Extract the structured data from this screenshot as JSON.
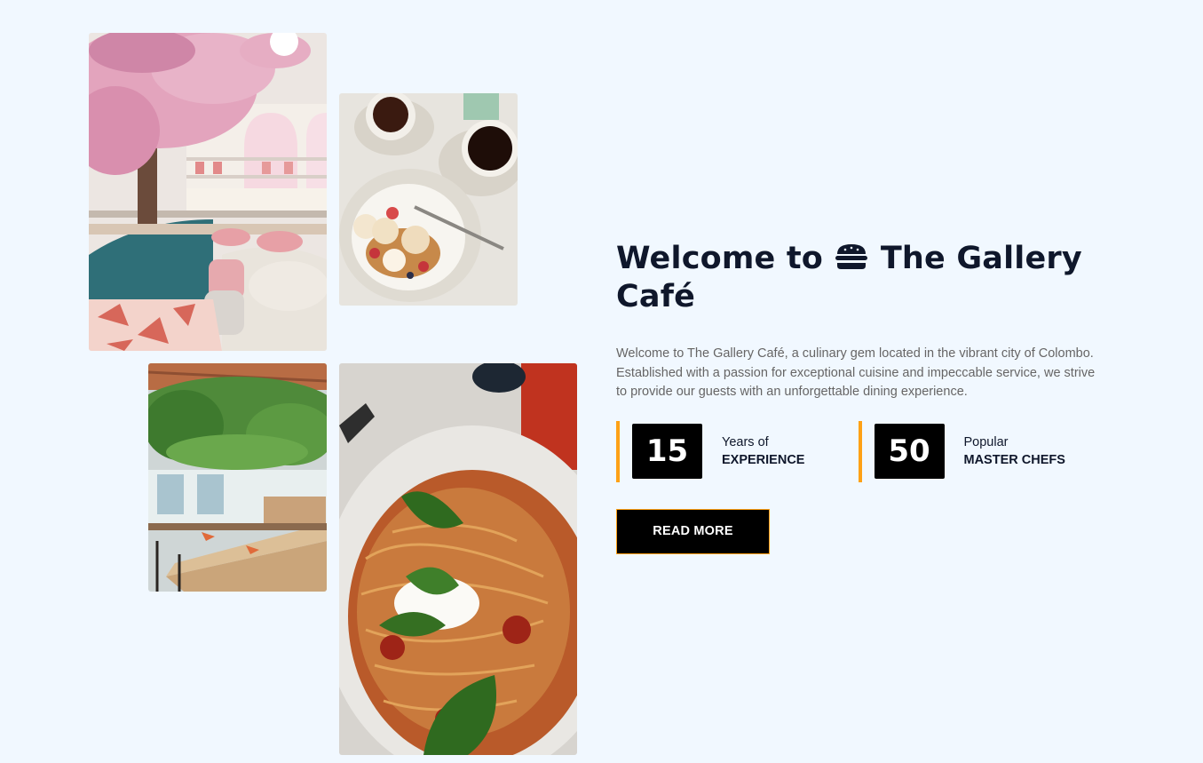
{
  "about": {
    "title_part1": "Welcome to",
    "title_icon": "burger-icon",
    "title_part2": "The Gallery Café",
    "description": "Welcome to The Gallery Café, a culinary gem located in the vibrant city of Colombo. Established with a passion for exceptional cuisine and impeccable service, we strive to provide our guests with an unforgettable dining experience.",
    "stats": [
      {
        "number": "15",
        "line1": "Years of",
        "line2": "EXPERIENCE"
      },
      {
        "number": "50",
        "line1": "Popular",
        "line2": "MASTER CHEFS"
      }
    ],
    "read_more_label": "READ MORE"
  },
  "colors": {
    "background": "#f1f8ff",
    "accent": "#fea116",
    "heading": "#0f172b",
    "text": "#666565"
  }
}
